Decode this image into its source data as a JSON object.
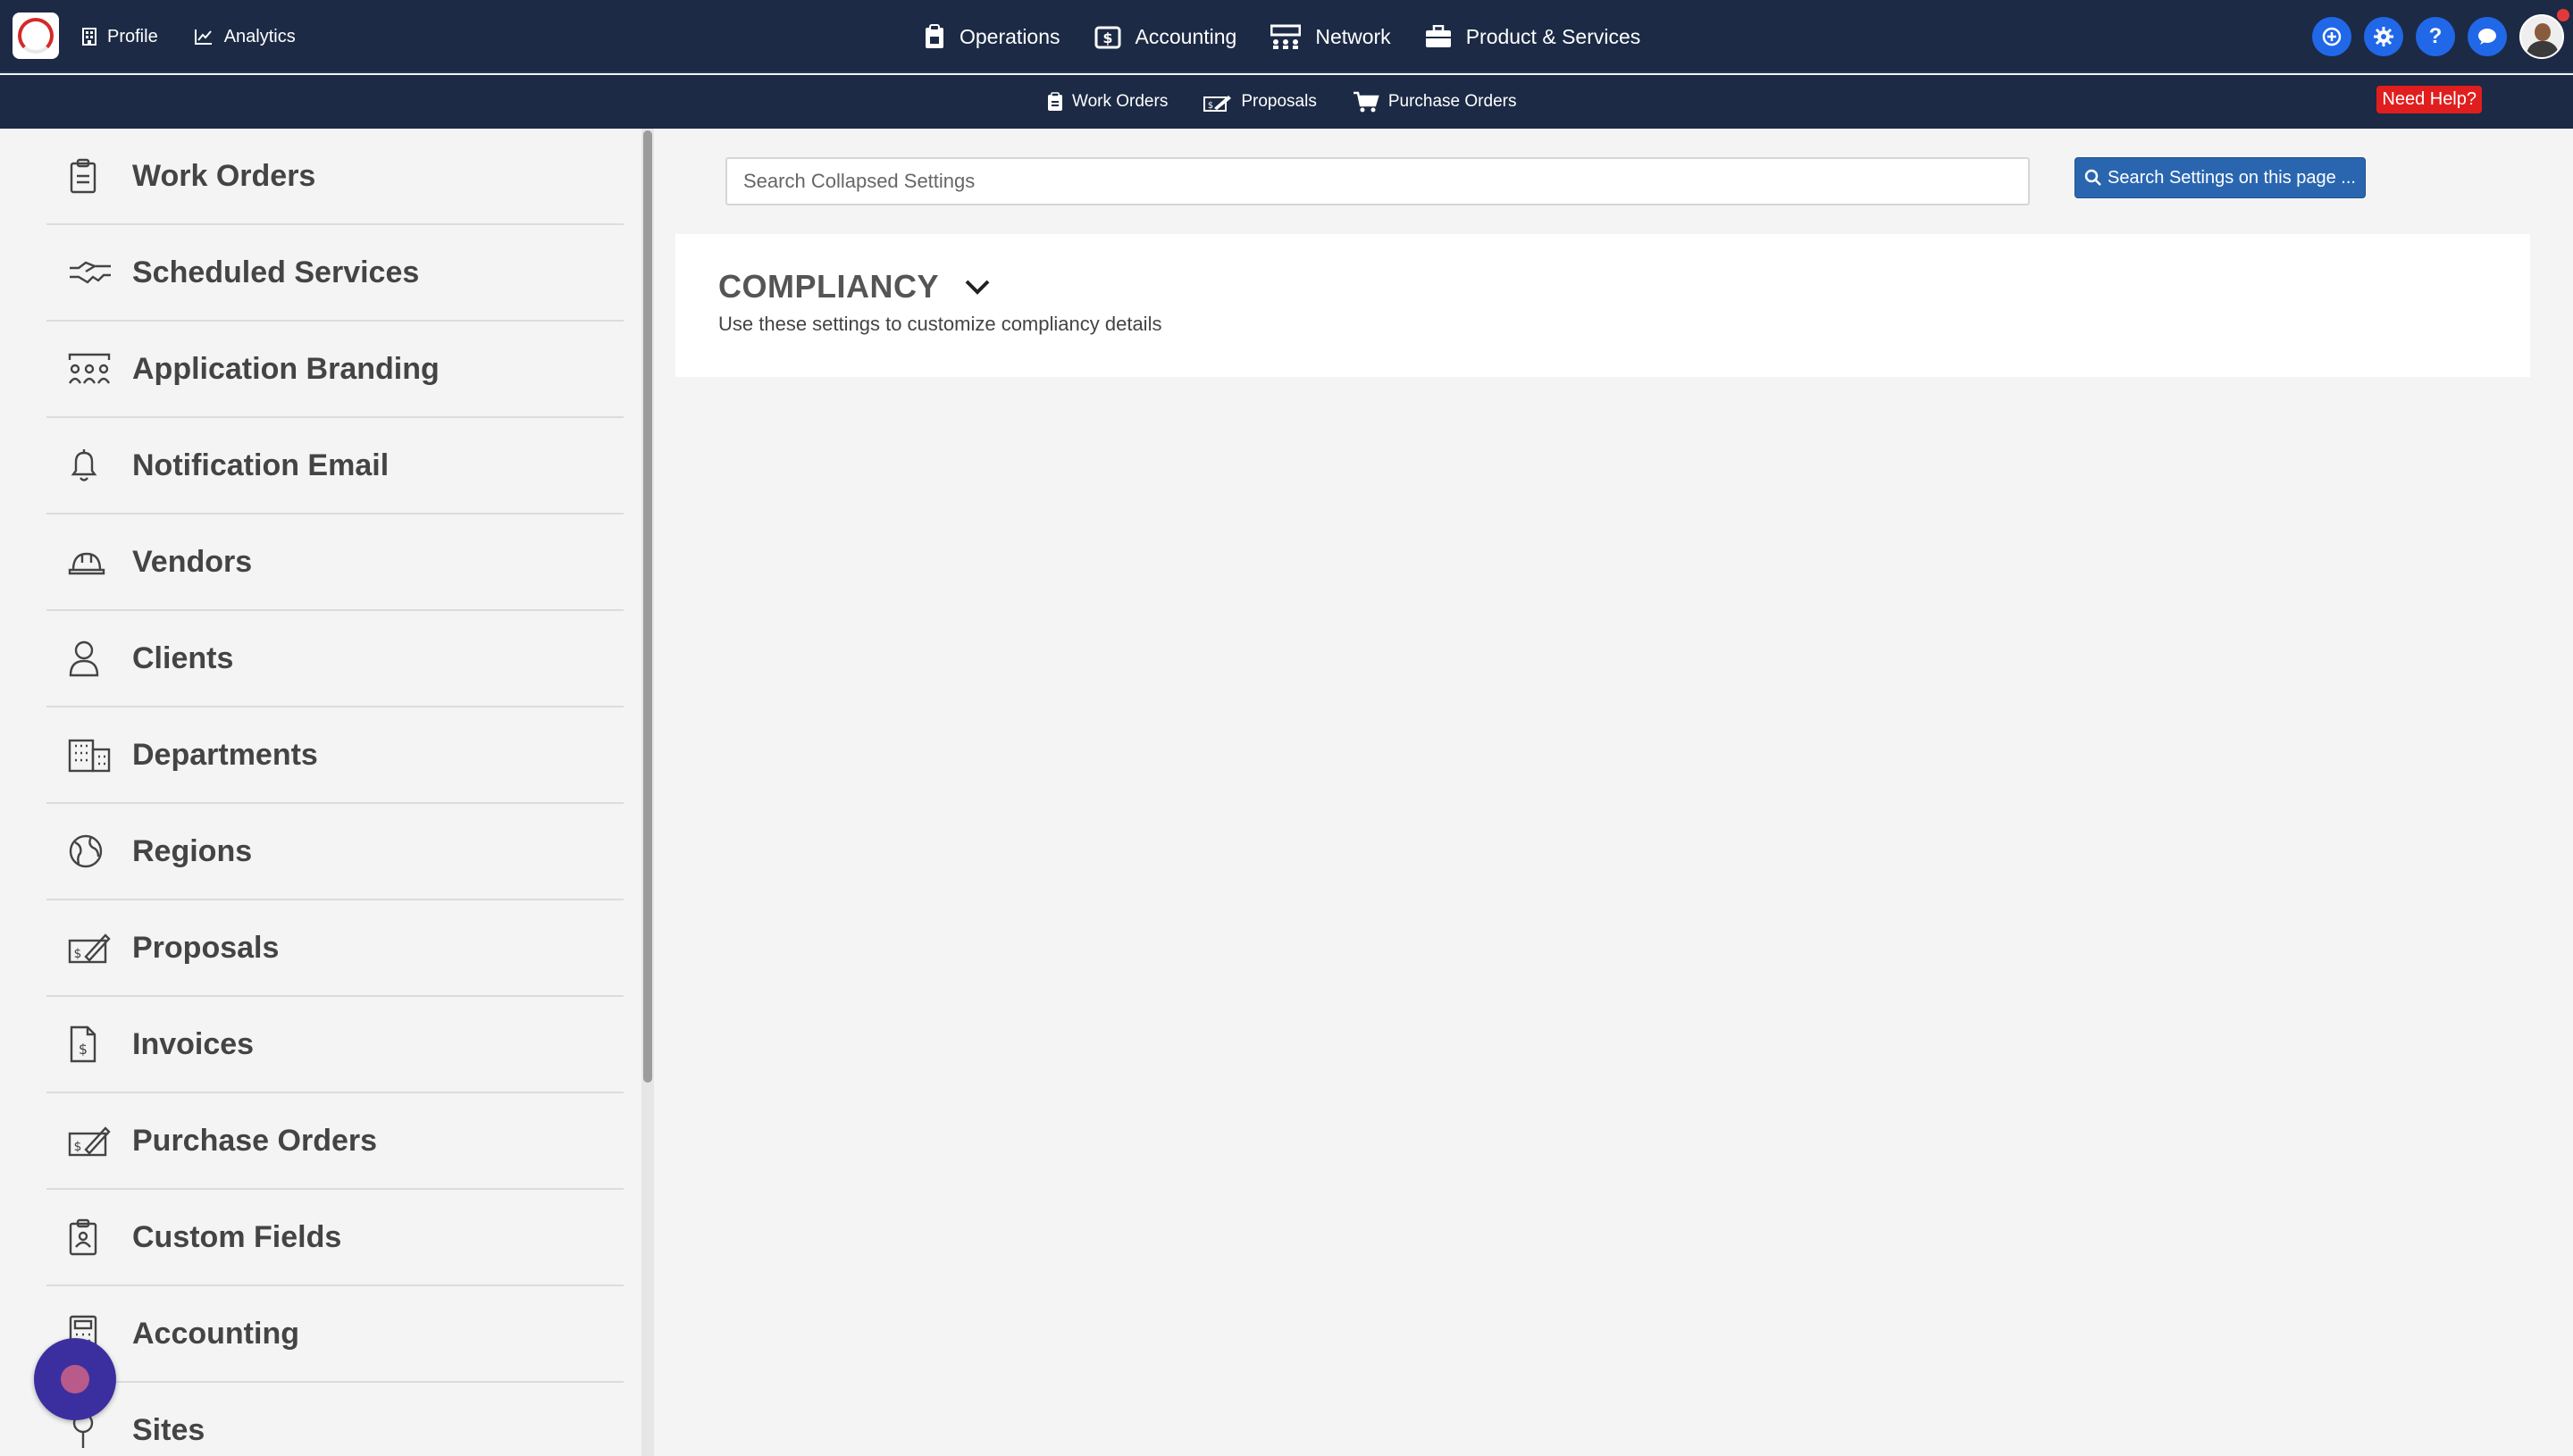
{
  "topbar": {
    "left_links": [
      {
        "label": "Profile",
        "icon": "building-icon"
      },
      {
        "label": "Analytics",
        "icon": "chart-line-icon"
      }
    ],
    "center_links": [
      {
        "label": "Operations",
        "icon": "clipboard-icon"
      },
      {
        "label": "Accounting",
        "icon": "money-box-icon"
      },
      {
        "label": "Network",
        "icon": "network-icon"
      },
      {
        "label": "Product & Services",
        "icon": "briefcase-icon"
      }
    ],
    "help_symbol": "?"
  },
  "subbar": {
    "links": [
      {
        "label": "Work Orders",
        "icon": "clipboard-icon"
      },
      {
        "label": "Proposals",
        "icon": "proposal-icon"
      },
      {
        "label": "Purchase Orders",
        "icon": "cart-icon"
      }
    ],
    "need_help": "Need Help?"
  },
  "sidebar": {
    "items": [
      {
        "label": "Work Orders",
        "icon": "clipboard-icon"
      },
      {
        "label": "Scheduled Services",
        "icon": "handshake-icon"
      },
      {
        "label": "Application Branding",
        "icon": "users-group-icon"
      },
      {
        "label": "Notification Email",
        "icon": "bell-icon"
      },
      {
        "label": "Vendors",
        "icon": "hard-hat-icon"
      },
      {
        "label": "Clients",
        "icon": "user-icon"
      },
      {
        "label": "Departments",
        "icon": "buildings-icon"
      },
      {
        "label": "Regions",
        "icon": "globe-icon"
      },
      {
        "label": "Proposals",
        "icon": "proposal-icon"
      },
      {
        "label": "Invoices",
        "icon": "invoice-icon"
      },
      {
        "label": "Purchase Orders",
        "icon": "proposal-icon"
      },
      {
        "label": "Custom Fields",
        "icon": "id-badge-icon"
      },
      {
        "label": "Accounting",
        "icon": "calculator-icon"
      },
      {
        "label": "Sites",
        "icon": "map-pin-icon"
      }
    ]
  },
  "main": {
    "search_placeholder": "Search Collapsed Settings",
    "search_button": "Search Settings on this page ...",
    "section": {
      "title": "COMPLIANCY",
      "description": "Use these settings to customize compliancy details"
    }
  },
  "colors": {
    "nav_bg": "#1c2a45",
    "accent_blue": "#2168e8",
    "button_blue": "#2a66b0",
    "help_red": "#e01e1e"
  }
}
